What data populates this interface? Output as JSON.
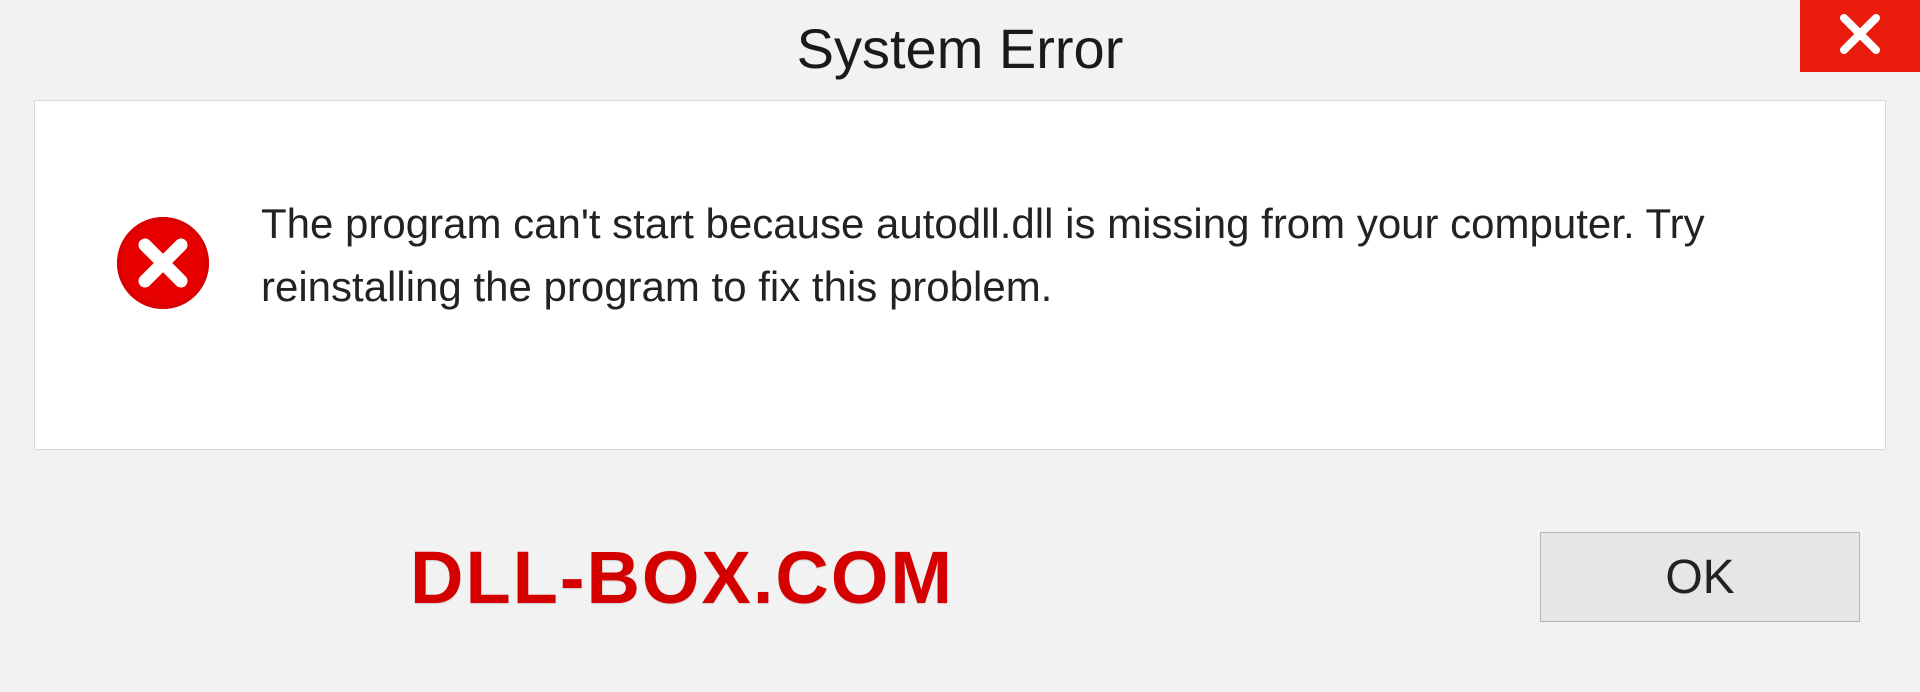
{
  "dialog": {
    "title": "System Error",
    "message": "The program can't start because autodll.dll is missing from your computer. Try reinstalling the program to fix this problem.",
    "ok_label": "OK"
  },
  "watermark": "DLL-BOX.COM"
}
